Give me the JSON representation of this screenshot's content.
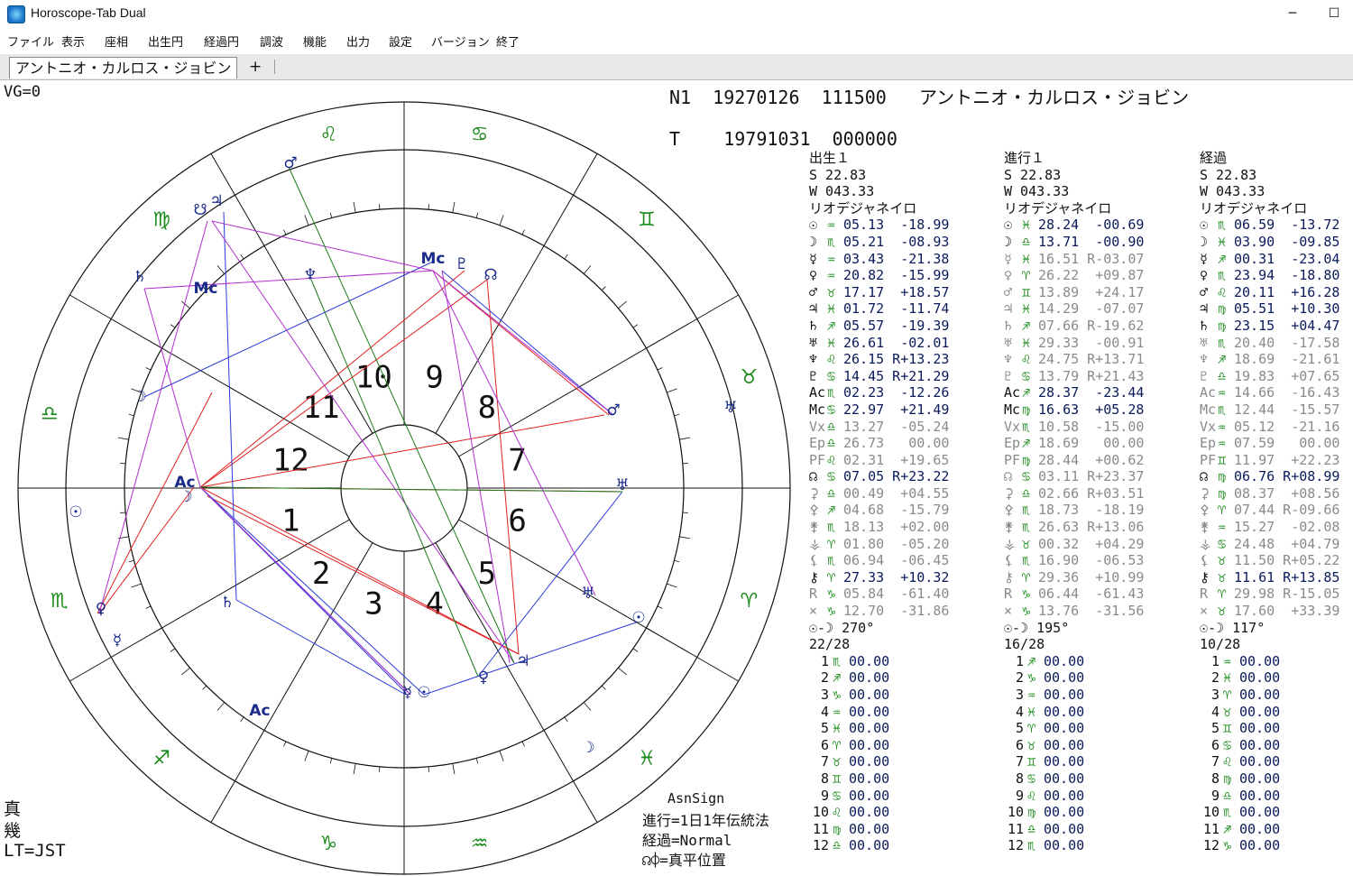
{
  "window": {
    "title": "Horoscope-Tab Dual",
    "minimize": "─",
    "maximize": "☐"
  },
  "menu": [
    "ファイル",
    "表示",
    "座相",
    "出生円",
    "経過円",
    "調波",
    "機能",
    "出力",
    "設定",
    "バージョン",
    "終了"
  ],
  "tab": {
    "label": "アントニオ・カルロス・ジョビン",
    "add": "+"
  },
  "chart": {
    "vg": "VG=0",
    "n1": "N1  19270126  111500   アントニオ・カルロス・ジョビン",
    "t": "T    19791031  000000",
    "house_numbers": [
      "1",
      "2",
      "3",
      "4",
      "5",
      "6",
      "7",
      "8",
      "9",
      "10",
      "11",
      "12"
    ],
    "zodiac_glyphs": [
      "♈",
      "♉",
      "♊",
      "♋",
      "♌",
      "♍",
      "♎",
      "♏",
      "♐",
      "♑",
      "♒",
      "♓"
    ],
    "bottom_left": {
      "l1": "真",
      "l2": "幾",
      "l3": "LT=JST"
    },
    "bottom_info": {
      "l1": "AsnSign",
      "l2": "進行=1日1年伝統法",
      "l3": "経過=Normal",
      "l4": "☊⌽=真平位置"
    },
    "colors": {
      "zodiac": "#1a8a1a",
      "red": "#e02020",
      "blue": "#2a3ad8",
      "magenta": "#b030d0",
      "green": "#1a7a1a"
    }
  },
  "columns": [
    {
      "title": "出生１",
      "s": "S  22.83",
      "w": "W 043.33",
      "place": "リオデジャネイロ",
      "rows": [
        {
          "g": "☉",
          "s": "♒",
          "v": "05.13  -18.99"
        },
        {
          "g": "☽",
          "s": "♏",
          "v": "05.21  -08.93"
        },
        {
          "g": "☿",
          "s": "♒",
          "v": "03.43  -21.38"
        },
        {
          "g": "♀",
          "s": "♒",
          "v": "20.82  -15.99"
        },
        {
          "g": "♂",
          "s": "♉",
          "v": "17.17  +18.57"
        },
        {
          "g": "♃",
          "s": "♓",
          "v": "01.72  -11.74"
        },
        {
          "g": "♄",
          "s": "♐",
          "v": "05.57  -19.39"
        },
        {
          "g": "♅",
          "s": "♓",
          "v": "26.61  -02.01"
        },
        {
          "g": "♆",
          "s": "♌",
          "v": "26.15 R+13.23"
        },
        {
          "g": "♇",
          "s": "♋",
          "v": "14.45 R+21.29"
        },
        {
          "g": "Ac",
          "s": "♏",
          "v": "02.23  -12.26"
        },
        {
          "g": "Mc",
          "s": "♋",
          "v": "22.97  +21.49"
        },
        {
          "g": "Vx",
          "s": "♎",
          "v": "13.27  -05.24",
          "dim": true
        },
        {
          "g": "Ep",
          "s": "♎",
          "v": "26.73   00.00",
          "dim": true
        },
        {
          "g": "PF",
          "s": "♌",
          "v": "02.31  +19.65",
          "dim": true
        },
        {
          "g": "☊",
          "s": "♋",
          "v": "07.05 R+23.22"
        },
        {
          "g": "⚳",
          "s": "♎",
          "v": "00.49  +04.55",
          "dim": true
        },
        {
          "g": "⚴",
          "s": "♐",
          "v": "04.68  -15.79",
          "dim": true
        },
        {
          "g": "⚵",
          "s": "♏",
          "v": "18.13  +02.00",
          "dim": true
        },
        {
          "g": "⚶",
          "s": "♈",
          "v": "01.80  -05.20",
          "dim": true
        },
        {
          "g": "⚸",
          "s": "♏",
          "v": "06.94  -06.45",
          "dim": true
        },
        {
          "g": "⚷",
          "s": "♈",
          "v": "27.33  +10.32"
        },
        {
          "g": "R",
          "s": "♑",
          "v": "05.84  -61.40",
          "dim": true
        },
        {
          "g": "×",
          "s": "♑",
          "v": "12.70  -31.86",
          "dim": true
        }
      ],
      "phase": "270°",
      "day": "22/28",
      "houses": [
        {
          "n": "1",
          "s": "♏",
          "v": "00.00"
        },
        {
          "n": "2",
          "s": "♐",
          "v": "00.00"
        },
        {
          "n": "3",
          "s": "♑",
          "v": "00.00"
        },
        {
          "n": "4",
          "s": "♒",
          "v": "00.00"
        },
        {
          "n": "5",
          "s": "♓",
          "v": "00.00"
        },
        {
          "n": "6",
          "s": "♈",
          "v": "00.00"
        },
        {
          "n": "7",
          "s": "♉",
          "v": "00.00"
        },
        {
          "n": "8",
          "s": "♊",
          "v": "00.00"
        },
        {
          "n": "9",
          "s": "♋",
          "v": "00.00"
        },
        {
          "n": "10",
          "s": "♌",
          "v": "00.00"
        },
        {
          "n": "11",
          "s": "♍",
          "v": "00.00"
        },
        {
          "n": "12",
          "s": "♎",
          "v": "00.00"
        }
      ]
    },
    {
      "title": "進行１",
      "s": "S  22.83",
      "w": "W 043.33",
      "place": "リオデジャネイロ",
      "rows": [
        {
          "g": "☉",
          "s": "♓",
          "v": "28.24  -00.69"
        },
        {
          "g": "☽",
          "s": "♎",
          "v": "13.71  -00.90"
        },
        {
          "g": "☿",
          "s": "♓",
          "v": "16.51 R-03.07",
          "dim": true
        },
        {
          "g": "♀",
          "s": "♈",
          "v": "26.22  +09.87",
          "dim": true
        },
        {
          "g": "♂",
          "s": "♊",
          "v": "13.89  +24.17",
          "dim": true
        },
        {
          "g": "♃",
          "s": "♓",
          "v": "14.29  -07.07",
          "dim": true
        },
        {
          "g": "♄",
          "s": "♐",
          "v": "07.66 R-19.62",
          "dim": true
        },
        {
          "g": "♅",
          "s": "♓",
          "v": "29.33  -00.91",
          "dim": true
        },
        {
          "g": "♆",
          "s": "♌",
          "v": "24.75 R+13.71",
          "dim": true
        },
        {
          "g": "♇",
          "s": "♋",
          "v": "13.79 R+21.43",
          "dim": true
        },
        {
          "g": "Ac",
          "s": "♐",
          "v": "28.37  -23.44"
        },
        {
          "g": "Mc",
          "s": "♍",
          "v": "16.63  +05.28"
        },
        {
          "g": "Vx",
          "s": "♏",
          "v": "10.58  -15.00",
          "dim": true
        },
        {
          "g": "Ep",
          "s": "♐",
          "v": "18.69   00.00",
          "dim": true
        },
        {
          "g": "PF",
          "s": "♍",
          "v": "28.44  +00.62",
          "dim": true
        },
        {
          "g": "☊",
          "s": "♋",
          "v": "03.11 R+23.37",
          "dim": true
        },
        {
          "g": "⚳",
          "s": "♎",
          "v": "02.66 R+03.51",
          "dim": true
        },
        {
          "g": "⚴",
          "s": "♏",
          "v": "18.73  -18.19",
          "dim": true
        },
        {
          "g": "⚵",
          "s": "♏",
          "v": "26.63 R+13.06",
          "dim": true
        },
        {
          "g": "⚶",
          "s": "♉",
          "v": "00.32  +04.29",
          "dim": true
        },
        {
          "g": "⚸",
          "s": "♏",
          "v": "16.90  -06.53",
          "dim": true
        },
        {
          "g": "⚷",
          "s": "♈",
          "v": "29.36  +10.99",
          "dim": true
        },
        {
          "g": "R",
          "s": "♑",
          "v": "06.44  -61.43",
          "dim": true
        },
        {
          "g": "×",
          "s": "♑",
          "v": "13.76  -31.56",
          "dim": true
        }
      ],
      "phase": "195°",
      "day": "16/28",
      "houses": [
        {
          "n": "1",
          "s": "♐",
          "v": "00.00"
        },
        {
          "n": "2",
          "s": "♑",
          "v": "00.00"
        },
        {
          "n": "3",
          "s": "♒",
          "v": "00.00"
        },
        {
          "n": "4",
          "s": "♓",
          "v": "00.00"
        },
        {
          "n": "5",
          "s": "♈",
          "v": "00.00"
        },
        {
          "n": "6",
          "s": "♉",
          "v": "00.00"
        },
        {
          "n": "7",
          "s": "♊",
          "v": "00.00"
        },
        {
          "n": "8",
          "s": "♋",
          "v": "00.00"
        },
        {
          "n": "9",
          "s": "♌",
          "v": "00.00"
        },
        {
          "n": "10",
          "s": "♍",
          "v": "00.00"
        },
        {
          "n": "11",
          "s": "♎",
          "v": "00.00"
        },
        {
          "n": "12",
          "s": "♏",
          "v": "00.00"
        }
      ]
    },
    {
      "title": "経過",
      "s": "S  22.83",
      "w": "W 043.33",
      "place": "リオデジャネイロ",
      "rows": [
        {
          "g": "☉",
          "s": "♏",
          "v": "06.59  -13.72"
        },
        {
          "g": "☽",
          "s": "♓",
          "v": "03.90  -09.85"
        },
        {
          "g": "☿",
          "s": "♐",
          "v": "00.31  -23.04"
        },
        {
          "g": "♀",
          "s": "♏",
          "v": "23.94  -18.80"
        },
        {
          "g": "♂",
          "s": "♌",
          "v": "20.11  +16.28"
        },
        {
          "g": "♃",
          "s": "♍",
          "v": "05.51  +10.30"
        },
        {
          "g": "♄",
          "s": "♍",
          "v": "23.15  +04.47"
        },
        {
          "g": "♅",
          "s": "♏",
          "v": "20.40  -17.58",
          "dim": true
        },
        {
          "g": "♆",
          "s": "♐",
          "v": "18.69  -21.61",
          "dim": true
        },
        {
          "g": "♇",
          "s": "♎",
          "v": "19.83  +07.65",
          "dim": true
        },
        {
          "g": "Ac",
          "s": "♒",
          "v": "14.66  -16.43",
          "dim": true
        },
        {
          "g": "Mc",
          "s": "♏",
          "v": "12.44  -15.57",
          "dim": true
        },
        {
          "g": "Vx",
          "s": "♒",
          "v": "05.12  -21.16",
          "dim": true
        },
        {
          "g": "Ep",
          "s": "♒",
          "v": "07.59   00.00",
          "dim": true
        },
        {
          "g": "PF",
          "s": "♊",
          "v": "11.97  +22.23",
          "dim": true
        },
        {
          "g": "☊",
          "s": "♍",
          "v": "06.76 R+08.99"
        },
        {
          "g": "⚳",
          "s": "♍",
          "v": "08.37  +08.56",
          "dim": true
        },
        {
          "g": "⚴",
          "s": "♈",
          "v": "07.44 R-09.66",
          "dim": true
        },
        {
          "g": "⚵",
          "s": "♒",
          "v": "15.27  -02.08",
          "dim": true
        },
        {
          "g": "⚶",
          "s": "♋",
          "v": "24.48  +04.79",
          "dim": true
        },
        {
          "g": "⚸",
          "s": "♉",
          "v": "11.50 R+05.22",
          "dim": true
        },
        {
          "g": "⚷",
          "s": "♉",
          "v": "11.61 R+13.85"
        },
        {
          "g": "R",
          "s": "♈",
          "v": "29.98 R-15.05",
          "dim": true
        },
        {
          "g": "×",
          "s": "♉",
          "v": "17.60  +33.39",
          "dim": true
        }
      ],
      "phase": "117°",
      "day": "10/28",
      "houses": [
        {
          "n": "1",
          "s": "♒",
          "v": "00.00"
        },
        {
          "n": "2",
          "s": "♓",
          "v": "00.00"
        },
        {
          "n": "3",
          "s": "♈",
          "v": "00.00"
        },
        {
          "n": "4",
          "s": "♉",
          "v": "00.00"
        },
        {
          "n": "5",
          "s": "♊",
          "v": "00.00"
        },
        {
          "n": "6",
          "s": "♋",
          "v": "00.00"
        },
        {
          "n": "7",
          "s": "♌",
          "v": "00.00"
        },
        {
          "n": "8",
          "s": "♍",
          "v": "00.00"
        },
        {
          "n": "9",
          "s": "♎",
          "v": "00.00"
        },
        {
          "n": "10",
          "s": "♏",
          "v": "00.00"
        },
        {
          "n": "11",
          "s": "♐",
          "v": "00.00"
        },
        {
          "n": "12",
          "s": "♑",
          "v": "00.00"
        }
      ]
    }
  ]
}
